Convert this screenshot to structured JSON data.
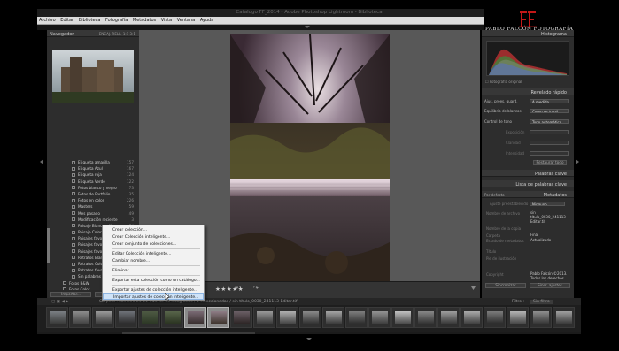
{
  "window": {
    "title": "Catalogo FF_2014 - Adobe Photoshop Lightroom - Biblioteca",
    "controls": "– □ ✕"
  },
  "menu": [
    "Archivo",
    "Editar",
    "Biblioteca",
    "Fotografía",
    "Metadatos",
    "Vista",
    "Ventana",
    "Ayuda"
  ],
  "logo": {
    "text": "PABLO FALCÓN   FOTOGRAFÍA"
  },
  "left": {
    "navigator_title": "Navegador",
    "nav_modes": "ENCAJ.  RELL.  1:1  3:1",
    "collections": [
      {
        "label": "Etiqueta amarilla",
        "count": "157"
      },
      {
        "label": "Etiqueta Azul",
        "count": "167"
      },
      {
        "label": "Etiqueta roja",
        "count": "124"
      },
      {
        "label": "Etiqueta Verde",
        "count": "122"
      },
      {
        "label": "Fotos blanco y negro",
        "count": "73"
      },
      {
        "label": "Fotos de Portfolio",
        "count": "35"
      },
      {
        "label": "Fotos en color",
        "count": "226"
      },
      {
        "label": "Masters",
        "count": "59"
      },
      {
        "label": "Mes pasado",
        "count": "49"
      },
      {
        "label": "Modificación reciente",
        "count": "3"
      },
      {
        "label": "Paisaje Blanco y Negro",
        "count": "74"
      },
      {
        "label": "Paisaje Color",
        "count": "63"
      },
      {
        "label": "Paisajes favoritos",
        "count": "49"
      },
      {
        "label": "Paisajes favoritos B&W",
        "count": "29"
      },
      {
        "label": "Paisajes favoritos color",
        "count": "41"
      },
      {
        "label": "Retratos Blanco y Negro",
        "count": "19"
      },
      {
        "label": "Retratos Color",
        "count": "18"
      },
      {
        "label": "Retratos favoritos",
        "count": "13"
      },
      {
        "label": "Sin palabras clave",
        "count": "6"
      }
    ],
    "top_collections": [
      {
        "label": "Fotos B&W",
        "count": ""
      },
      {
        "label": "Fotos Color",
        "count": ""
      },
      {
        "label": "proyeccion",
        "count": ""
      }
    ],
    "import_btn": "Importar...",
    "export_btn": "Exportar..."
  },
  "context_menu": {
    "items": [
      "Crear colección...",
      "Crear Colección inteligente...",
      "Crear conjunto de colecciones...",
      "Editar Colección inteligente...",
      "Cambiar nombre...",
      "Eliminar...",
      "Exportar esta colección como un catálogo...",
      "Exportar ajustes de colección inteligente...",
      "Importar ajustes de colección inteligente..."
    ],
    "highlighted_index": 8
  },
  "right": {
    "histogram_title": "Histograma",
    "original_photo": "Fotografía original",
    "quick_develop": "Revelado rápido",
    "qd_rows": [
      {
        "k": "Ajus. prees. guard.",
        "v": "A medida"
      },
      {
        "k": "Equilibrio de blancos",
        "v": "Como se tomó"
      },
      {
        "k": "Control de tono",
        "v": "Tono automático"
      },
      {
        "k": "Exposición",
        "v": ""
      },
      {
        "k": "Claridad",
        "v": ""
      },
      {
        "k": "Intensidad",
        "v": ""
      }
    ],
    "reset_all": "Restaurar todo",
    "keywords": "Palabras clave",
    "keyword_list": "Lista de palabras clave",
    "metadata": "Metadatos",
    "meta_preset_label": "Por defecto",
    "meta_preset_value": "Ninguno",
    "meta_rows": [
      {
        "k": "Nombre de archivo",
        "v": "sin título_0030_241113-Editar.tif"
      },
      {
        "k": "Nombre de la copia",
        "v": ""
      },
      {
        "k": "Carpeta",
        "v": "Final"
      },
      {
        "k": "Estado de metadatos",
        "v": "Actualizado"
      },
      {
        "k": "Título",
        "v": ""
      },
      {
        "k": "Pie de ilustración",
        "v": ""
      },
      {
        "k": "Copyright",
        "v": "Pablo Falcón ©2013. Todos los derechos reservados"
      }
    ],
    "sync_btn": "Sincronizar",
    "sync_settings_btn": "Sincr. ajustes"
  },
  "filmstrip": {
    "path": "Carpeta : Lameiro 24-11-13",
    "count": "10 de 66 fotografías / 1 seleccionadas / sin título_0030_241113-Editar.tif",
    "filter_label": "Filtro :",
    "filter_value": "Sin filtro"
  },
  "accent_color": "#cfe3f8"
}
